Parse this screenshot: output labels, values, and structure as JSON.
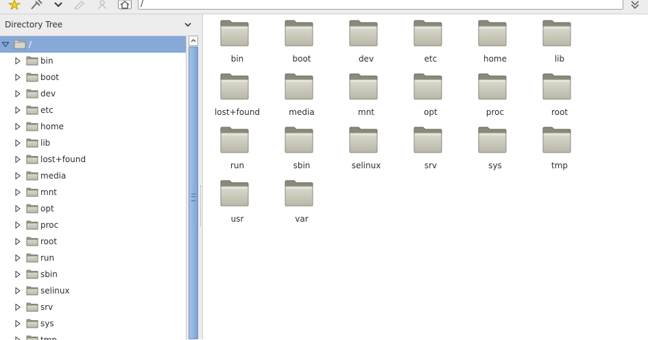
{
  "toolbar": {
    "location_value": "/",
    "icons": [
      "bookmark-star-icon",
      "tools-icon",
      "dropdown-icon",
      "edit-icon",
      "network-icon",
      "home-icon",
      "go-icon"
    ]
  },
  "sidebar": {
    "header": "Directory Tree",
    "root_label": "/",
    "items": [
      "bin",
      "boot",
      "dev",
      "etc",
      "home",
      "lib",
      "lost+found",
      "media",
      "mnt",
      "opt",
      "proc",
      "root",
      "run",
      "sbin",
      "selinux",
      "srv",
      "sys",
      "tmp"
    ]
  },
  "main": {
    "items": [
      "bin",
      "boot",
      "dev",
      "etc",
      "home",
      "lib",
      "lost+found",
      "media",
      "mnt",
      "opt",
      "proc",
      "root",
      "run",
      "sbin",
      "selinux",
      "srv",
      "sys",
      "tmp",
      "usr",
      "var"
    ]
  },
  "colors": {
    "selection": "#86a9d8",
    "folder_body": "#c9c8b8",
    "folder_tab": "#8f8e80"
  }
}
